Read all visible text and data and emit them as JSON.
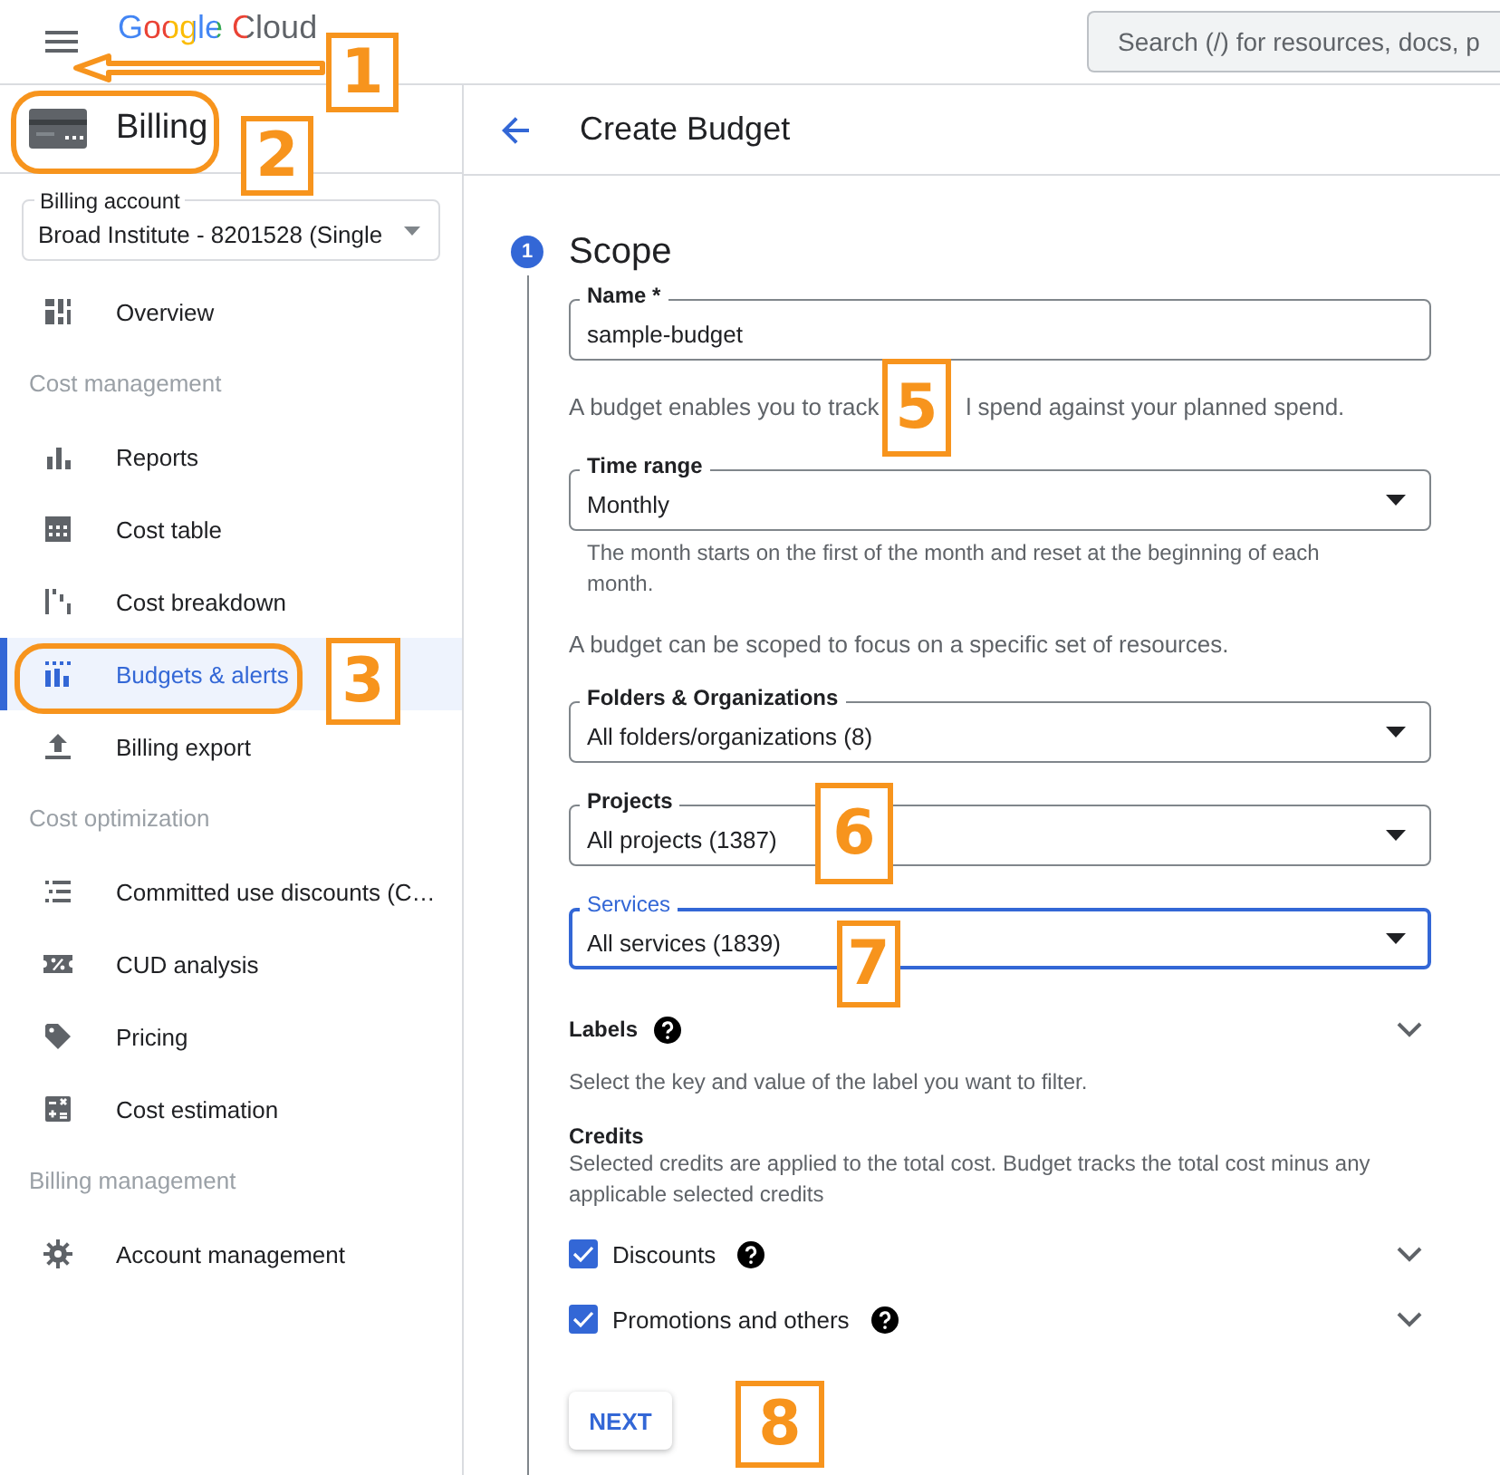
{
  "top_bar": {
    "logo": "Google Cloud",
    "search": {
      "placeholder": "Search (/) for resources, docs, p"
    }
  },
  "sidebar": {
    "title": "Billing",
    "billing_account": {
      "label": "Billing account",
      "value": "Broad Institute - 8201528 (Single"
    },
    "items": [
      {
        "kind": "item",
        "label": "Overview",
        "selected": false
      },
      {
        "kind": "heading",
        "label": "Cost management"
      },
      {
        "kind": "item",
        "label": "Reports",
        "selected": false
      },
      {
        "kind": "item",
        "label": "Cost table",
        "selected": false
      },
      {
        "kind": "item",
        "label": "Cost breakdown",
        "selected": false
      },
      {
        "kind": "item",
        "label": "Budgets & alerts",
        "selected": true
      },
      {
        "kind": "item",
        "label": "Billing export",
        "selected": false
      },
      {
        "kind": "heading",
        "label": "Cost optimization"
      },
      {
        "kind": "item",
        "label": "Committed use discounts (C…",
        "selected": false
      },
      {
        "kind": "item",
        "label": "CUD analysis",
        "selected": false
      },
      {
        "kind": "item",
        "label": "Pricing",
        "selected": false
      },
      {
        "kind": "item",
        "label": "Cost estimation",
        "selected": false
      },
      {
        "kind": "heading",
        "label": "Billing management"
      },
      {
        "kind": "item",
        "label": "Account management",
        "selected": false
      }
    ]
  },
  "page": {
    "title": "Create Budget",
    "step": {
      "number": "1",
      "title": "Scope"
    },
    "name_field": {
      "label": "Name *",
      "value": "sample-budget"
    },
    "budget_help": [
      "A budget enables you to track",
      "l spend against your planned spend."
    ],
    "time_range": {
      "label": "Time range",
      "value": "Monthly",
      "hint": "The month starts on the first of the month and reset at the beginning of each month."
    },
    "scope_help": "A budget can be scoped to focus on a specific set of resources.",
    "selects": [
      {
        "label": "Folders & Organizations",
        "value": "All folders/organizations (8)",
        "focused": false
      },
      {
        "label": "Projects",
        "value": "All projects (1387)",
        "focused": false
      },
      {
        "label": "Services",
        "value": "All services (1839)",
        "focused": true
      }
    ],
    "labels": {
      "title": "Labels",
      "help": "Select the key and value of the label you want to filter."
    },
    "credits": {
      "title": "Credits",
      "description": "Selected credits are applied to the total cost. Budget tracks the total cost minus any applicable selected credits",
      "options": [
        {
          "label": "Discounts",
          "checked": true
        },
        {
          "label": "Promotions and others",
          "checked": true
        }
      ]
    },
    "next_button": "NEXT"
  },
  "annotations": [
    {
      "label": "1"
    },
    {
      "label": "2"
    },
    {
      "label": "3"
    },
    {
      "label": "5"
    },
    {
      "label": "6"
    },
    {
      "label": "7"
    },
    {
      "label": "8"
    }
  ]
}
